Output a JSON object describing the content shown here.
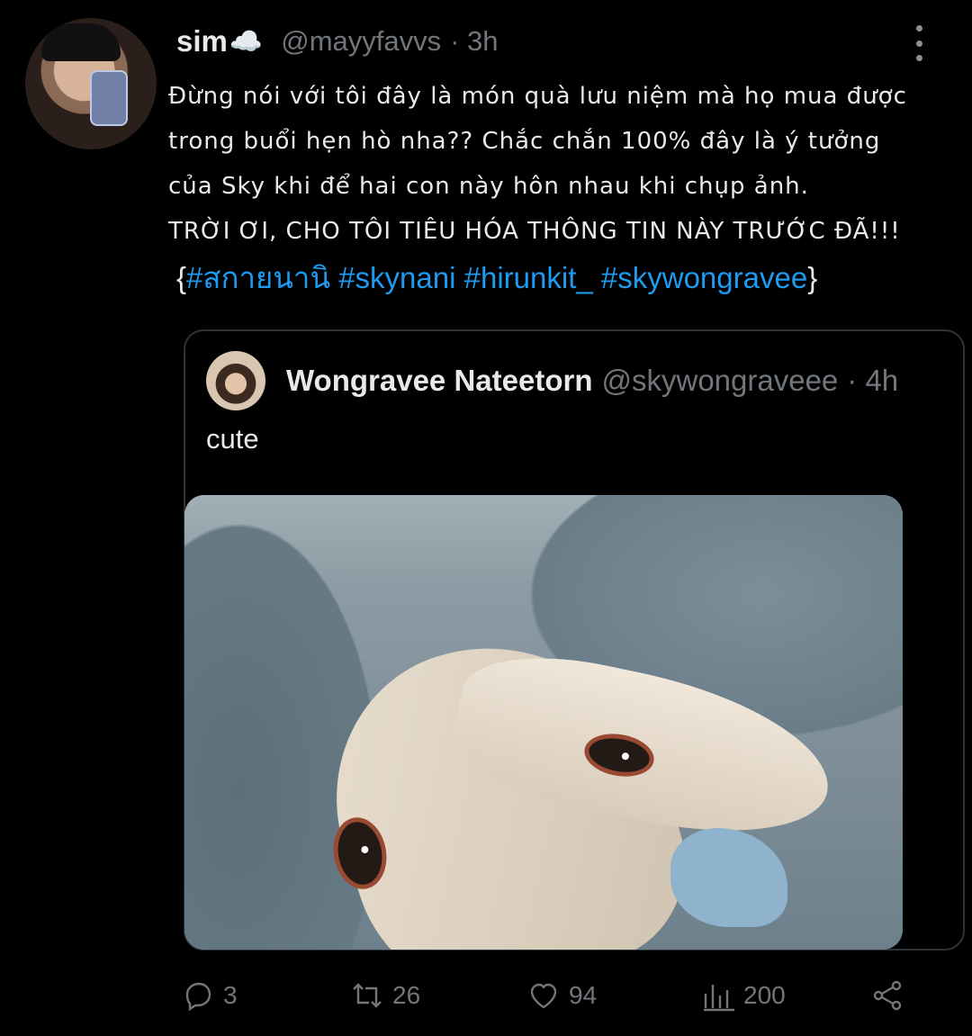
{
  "tweet": {
    "display_name": "sim",
    "name_emoji": "☁️",
    "handle": "@mayyfavvs",
    "time": "· 3h",
    "lines": [
      "Đừng nói với tôi đây là món quà lưu niệm mà họ mua được",
      "trong buổi hẹn hò nha?? Chắc chắn 100% đây là ý tưởng",
      "của Sky khi để hai con này hôn nhau khi chụp ảnh.",
      "TRỜI ƠI, CHO TÔI TIÊU HÓA THÔNG TIN NÀY TRƯỚC ĐÃ!!!"
    ],
    "hashtags_open": "{",
    "hashtags": [
      "#สกายนานิ",
      "#skynani",
      "#hirunkit_",
      "#skywongravee"
    ],
    "hashtags_close": "}"
  },
  "quoted": {
    "display_name": "Wongravee Nateetorn",
    "handle": "@skywongraveee",
    "time": "· 4h",
    "text": "cute"
  },
  "actions": {
    "replies": "3",
    "retweets": "26",
    "likes": "94",
    "views": "200"
  },
  "icons": {
    "more": "more-vertical-icon",
    "reply": "reply-icon",
    "retweet": "retweet-icon",
    "like": "heart-icon",
    "views": "views-icon",
    "share": "share-icon"
  },
  "colors": {
    "background": "#000000",
    "text": "#e7e9ea",
    "muted": "#71767b",
    "link": "#1d9bf0",
    "border": "#2f3336"
  }
}
